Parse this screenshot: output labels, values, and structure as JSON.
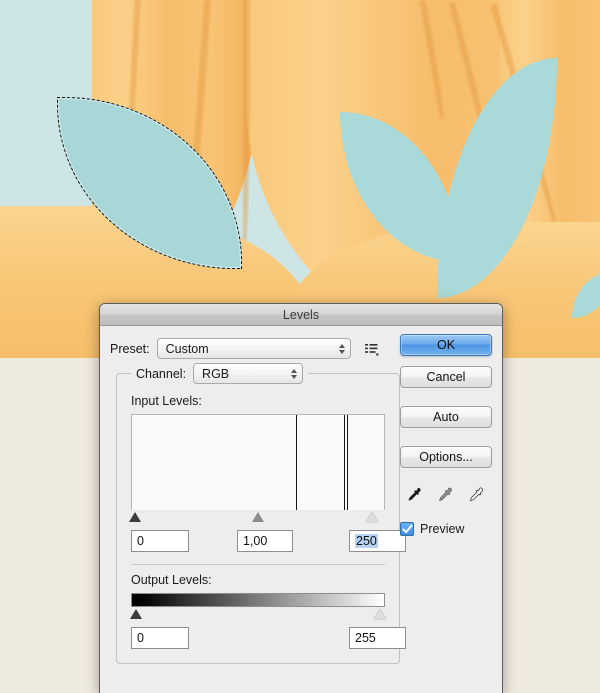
{
  "canvas": {
    "name": "photoshop-canvas",
    "description": "Illustration of orange ribbon petals with teal leaf shapes on a pale blue background",
    "colors": {
      "sky": "#cde6e5",
      "petal_orange": "#f5bc69",
      "ribbon_light": "#fbd18a",
      "ribbon_dark": "#f2ad55",
      "leaf_teal": "#a9d9d8",
      "page_background": "#efeade",
      "selection_fill": "#a9d7d7"
    },
    "selection": {
      "label": "marching-ants-selection",
      "shape": "leaf"
    }
  },
  "dialog": {
    "title": "Levels",
    "preset": {
      "label": "Preset:",
      "value": "Custom",
      "menu_icon": "preset-options-menu-icon"
    },
    "channel": {
      "label": "Channel:",
      "value": "RGB"
    },
    "input_levels": {
      "label": "Input Levels:",
      "shadow": "0",
      "midtone": "1,00",
      "highlight": "250",
      "highlight_selected": true,
      "marker_positions_pct": [
        0.5,
        50,
        95.5
      ],
      "histogram": {
        "spikes_pct": [
          65,
          84,
          85.5
        ],
        "range": [
          0,
          255
        ]
      }
    },
    "output_levels": {
      "label": "Output Levels:",
      "black": "0",
      "white": "255",
      "marker_positions_pct": [
        1,
        98
      ]
    },
    "buttons": {
      "ok": "OK",
      "cancel": "Cancel",
      "auto": "Auto",
      "options": "Options..."
    },
    "eyedroppers": [
      {
        "name": "set-black-point-eyedropper",
        "tone": "black"
      },
      {
        "name": "set-gray-point-eyedropper",
        "tone": "gray"
      },
      {
        "name": "set-white-point-eyedropper",
        "tone": "white"
      }
    ],
    "preview": {
      "label": "Preview",
      "checked": true,
      "accent": "#3d8de0"
    }
  }
}
